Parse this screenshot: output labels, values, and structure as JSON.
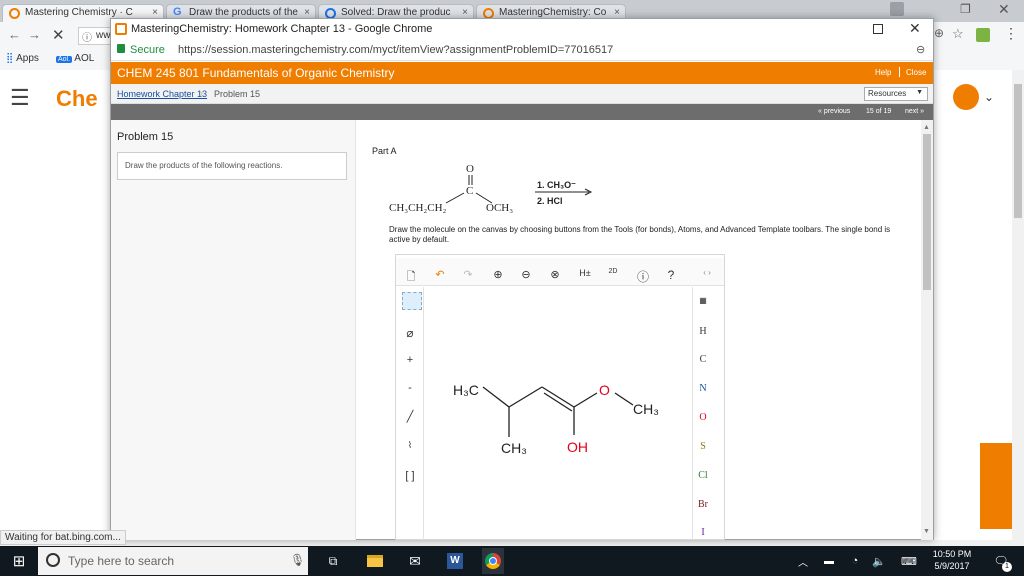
{
  "browser_tabs": [
    {
      "title": "Mastering Chemistry · C",
      "active": false
    },
    {
      "title": "Draw the products of the",
      "active": false
    },
    {
      "title": "Solved: Draw the produc",
      "active": false
    },
    {
      "title": "MasteringChemistry: Co",
      "active": false
    }
  ],
  "popup": {
    "title": "MasteringChemistry: Homework Chapter 13 - Google Chrome",
    "secure_label": "Secure",
    "url": "https://session.masteringchemistry.com/myct/itemView?assignmentProblemID=77016517",
    "course_title": "CHEM 245 801 Fundamentals of Organic Chemistry",
    "help": "Help",
    "close": "Close",
    "breadcrumb_link": "Homework Chapter 13",
    "breadcrumb_current": "Problem 15",
    "resources": "Resources",
    "previous": "« previous",
    "position": "15 of 19",
    "next": "next »",
    "problem_heading": "Problem 15",
    "problem_prompt": "Draw the products of the following reactions.",
    "part_label": "Part A",
    "reagent1": "1. CH₃O⁻",
    "reagent2": "2. HCl",
    "reactant_left": "CH₃CH₂CH₂",
    "reactant_right": "OCH₃",
    "carbonyl_o": "O",
    "carbonyl_c": "C",
    "instructions": "Draw the molecule on the canvas by choosing buttons from the Tools (for bonds), Atoms, and Advanced Template toolbars. The single bond is active by default.",
    "canvas_labels": {
      "h3c": "H₃C",
      "o": "O",
      "ch3_right": "CH₃",
      "ch3_bottom": "CH₃",
      "oh": "OH"
    },
    "atoms": [
      "H",
      "C",
      "N",
      "O",
      "S",
      "Cl",
      "Br",
      "I"
    ],
    "toolbar": {
      "h_plus": "H±",
      "page_2d": "2D"
    }
  },
  "background_page": {
    "brand_partial": "Che",
    "bookmarks": {
      "apps": "Apps",
      "aol": "AOL",
      "aol_badge": "Aol."
    },
    "omnibox_partial": "ww"
  },
  "status_bar": "Waiting for bat.bing.com...",
  "taskbar": {
    "search_placeholder": "Type here to search",
    "time": "10:50 PM",
    "date": "5/9/2017",
    "notification_count": "1"
  },
  "colors": {
    "orange": "#ef7d00",
    "nav_gray": "#6d6d6d",
    "link_blue": "#1a4fa0",
    "red_atom": "#e2001a"
  }
}
